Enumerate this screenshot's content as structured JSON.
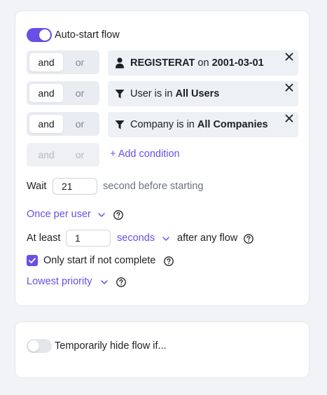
{
  "auto_start": {
    "toggle_on": true,
    "label": "Auto-start flow"
  },
  "conditions": [
    {
      "and_label": "and",
      "or_label": "or",
      "icon": "user-icon",
      "prefix": "",
      "bold1": "REGISTERAT",
      "middle": " on ",
      "bold2": "2001-03-01"
    },
    {
      "and_label": "and",
      "or_label": "or",
      "icon": "filter-icon",
      "prefix": "User is in ",
      "bold1": "All Users"
    },
    {
      "and_label": "and",
      "or_label": "or",
      "icon": "filter-icon",
      "prefix": "Company is in ",
      "bold1": "All Companies"
    }
  ],
  "add_row": {
    "and_label": "and",
    "or_label": "or",
    "add_condition_label": "+ Add condition"
  },
  "wait": {
    "label": "Wait",
    "value": "21",
    "suffix": "second before starting"
  },
  "frequency": {
    "label": "Once per user"
  },
  "at_least": {
    "label": "At least",
    "value": "1",
    "unit": "seconds",
    "suffix": "after any flow"
  },
  "only_start": {
    "checked": true,
    "label": "Only start if not complete"
  },
  "priority": {
    "label": "Lowest priority"
  },
  "hide_flow": {
    "toggle_on": false,
    "label": "Temporarily hide flow if..."
  },
  "colors": {
    "accent": "#6b4ee6",
    "background": "#f1f3f7",
    "card": "#ffffff",
    "condition_bg": "#edf0f4"
  }
}
